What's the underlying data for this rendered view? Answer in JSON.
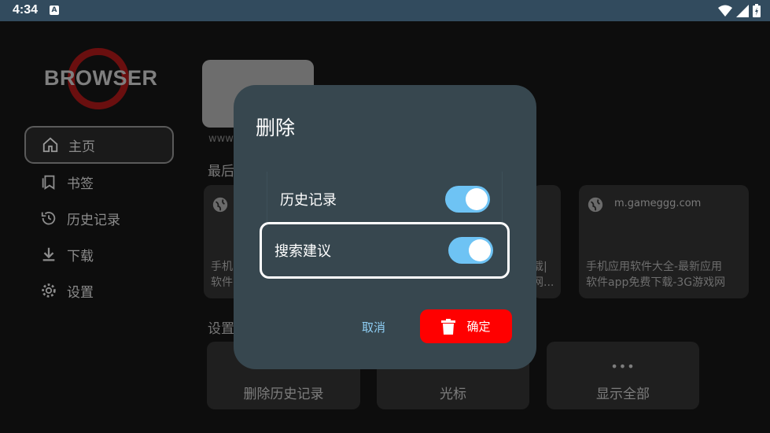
{
  "status_bar": {
    "time": "4:34",
    "notification_badge": "A"
  },
  "sidebar": {
    "logo_text": "BROWSER",
    "items": [
      {
        "label": "主页",
        "icon": "home-icon",
        "active": true
      },
      {
        "label": "书签",
        "icon": "bookmark-icon",
        "active": false
      },
      {
        "label": "历史记录",
        "icon": "history-icon",
        "active": false
      },
      {
        "label": "下载",
        "icon": "download-icon",
        "active": false
      },
      {
        "label": "设置",
        "icon": "gear-icon",
        "active": false
      }
    ]
  },
  "main": {
    "thumb_url": "www",
    "recent_section_label": "最后",
    "cards": [
      {
        "url": "",
        "desc_line1": "手机",
        "desc_line2": "软件"
      },
      {
        "url": "",
        "desc_line1": "载|",
        "desc_line2": "网..."
      },
      {
        "url": "m.gameggg.com",
        "desc_line1": "手机应用软件大全-最新应用",
        "desc_line2": "软件app免费下载-3G游戏网"
      }
    ],
    "settings_section_label": "设置",
    "actions": [
      {
        "label": "删除历史记录"
      },
      {
        "label": "光标"
      },
      {
        "label": "显示全部"
      }
    ]
  },
  "dialog": {
    "title": "删除",
    "options": [
      {
        "label": "历史记录",
        "checked": true
      },
      {
        "label": "搜索建议",
        "checked": true
      }
    ],
    "cancel_label": "取消",
    "confirm_label": "确定"
  },
  "colors": {
    "dialog_bg": "#37474f",
    "switch_on": "#6ec3f4",
    "confirm_bg": "#ff0000",
    "statusbar_bg": "#324b5e"
  }
}
